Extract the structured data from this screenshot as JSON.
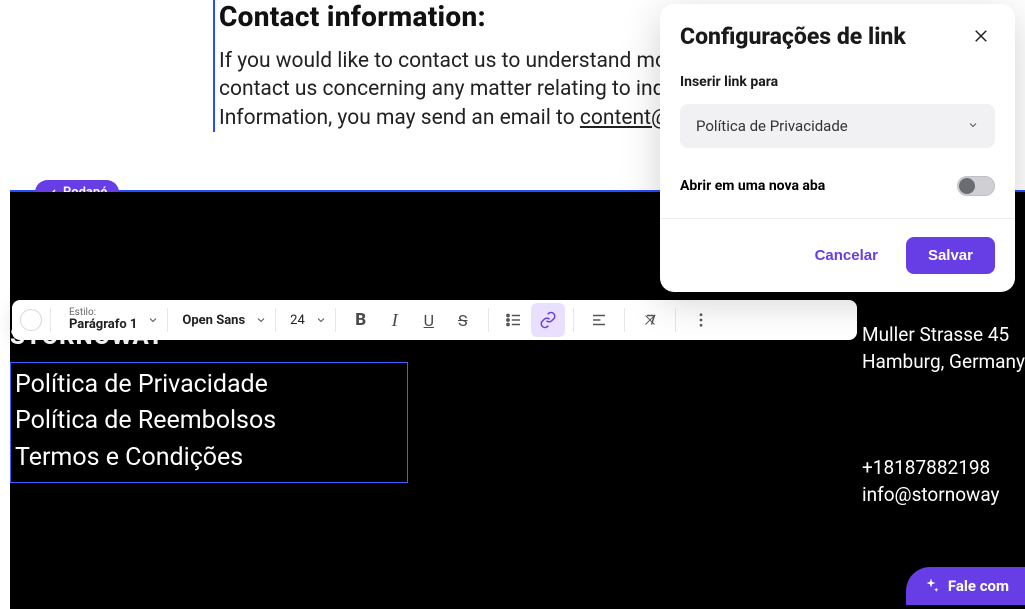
{
  "content": {
    "heading": "Contact information:",
    "paragraph_pre": "If you would like to contact us to understand more about this Policy or wish to contact us concerning any matter relating to individual rights and your Personal Information, you may send an email to ",
    "email": "content@hostinger.com",
    "paragraph_post": "."
  },
  "section_pill": "Rodapé",
  "footer": {
    "brand": "STORNOWAY",
    "links": [
      "Política de Privacidade",
      "Política de Reembolsos",
      "Termos e Condições"
    ],
    "address": [
      "Muller Strasse 45",
      "Hamburg, Germany"
    ],
    "contact": [
      "+18187882198",
      "info@stornoway"
    ]
  },
  "toolbar": {
    "style_label": "Estilo:",
    "style_value": "Parágrafo 1",
    "font": "Open Sans",
    "size": "24",
    "bold": "B",
    "italic": "I",
    "underline": "U",
    "strike": "S"
  },
  "popover": {
    "title": "Configurações de link",
    "insert_label": "Inserir link para",
    "select_value": "Política de Privacidade",
    "newtab_label": "Abrir em uma nova aba",
    "cancel": "Cancelar",
    "save": "Salvar"
  },
  "chat": {
    "label": "Fale com"
  }
}
